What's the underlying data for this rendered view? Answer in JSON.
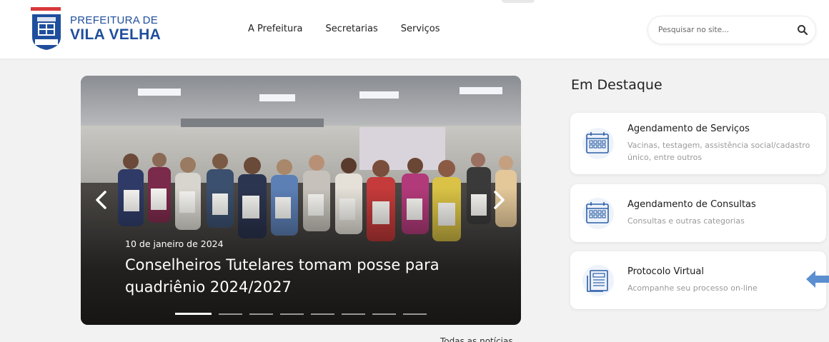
{
  "header": {
    "logo_line1": "PREFEITURA DE",
    "logo_line2": "VILA VELHA",
    "logo_emblem_text": "VILA VELHA",
    "nav": [
      "A Prefeitura",
      "Secretarias",
      "Serviços"
    ],
    "search_placeholder": "Pesquisar no site..."
  },
  "carousel": {
    "date": "10 de janeiro de 2024",
    "title": "Conselheiros Tutelares tomam posse para quadriênio 2024/2027",
    "slide_count": 8,
    "active_slide": 1
  },
  "all_news_label": "Todas as notícias",
  "destaque": {
    "heading": "Em Destaque",
    "cards": [
      {
        "title": "Agendamento de Serviços",
        "subtitle": "Vacinas, testagem, assistência social/cadastro único, entre outros",
        "icon": "calendar-icon"
      },
      {
        "title": "Agendamento de Consultas",
        "subtitle": "Consultas e outras categorias",
        "icon": "calendar-icon"
      },
      {
        "title": "Protocolo Virtual",
        "subtitle": "Acompanhe seu processo on-line",
        "icon": "document-icon"
      }
    ]
  },
  "colors": {
    "brand_blue": "#1f4e9c",
    "brand_red": "#d8383a",
    "icon_blue": "#2d5fa8",
    "pointer_blue": "#5b8fd0"
  }
}
